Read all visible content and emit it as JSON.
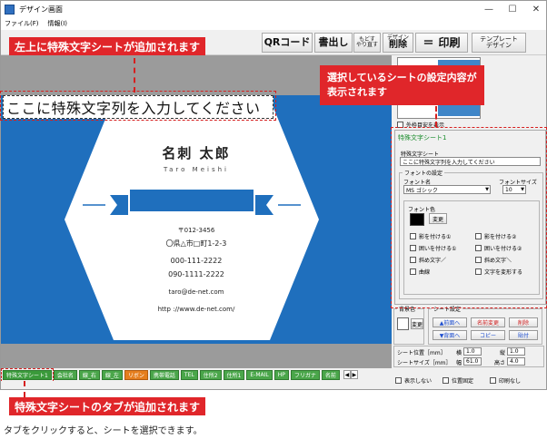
{
  "window": {
    "title": "デザイン画面",
    "controls": [
      "—",
      "☐",
      "✕"
    ]
  },
  "menu": [
    "ファイル(F)",
    "情報(I)"
  ],
  "toolbar": {
    "qr": "QRコード",
    "write": "書出し",
    "undo_top": "もどす",
    "undo_bottom": "やり直す",
    "del_top": "デザイン",
    "del_bottom": "削除",
    "print_sym": "＝",
    "print": "印刷",
    "tmpl_top": "テンプレート",
    "tmpl_bottom": "デザイン"
  },
  "card": {
    "special_text": "ここに特殊文字列を入力してください",
    "name": "名刺 太郎",
    "romaji": "Taro Meishi",
    "postal": "〒012-3456",
    "address": "〇県△市□町1-2-3",
    "tel": "000-111-2222",
    "mobile": "090-1111-2222",
    "email": "taro@de-net.com",
    "url": "http ://www.de-net.com/"
  },
  "panel": {
    "checkbox_label": "外枠目安を表示",
    "sheet_title": "特殊文字シート1",
    "text_label": "特殊文字シート",
    "text_value": "ここに特殊文字列を入力してください",
    "font_group": "フォントの設定",
    "font_name_label": "フォント名",
    "font_size_label": "フォントサイズ",
    "font_name": "MS ゴシック",
    "font_size": "10",
    "font_color_label": "フォント色",
    "change": "変更",
    "opts": [
      "影を付ける①",
      "影を付ける②",
      "囲いを付ける①",
      "囲いを付ける②",
      "斜め文字／",
      "斜め文字＼",
      "曲線",
      "文字を変形する"
    ]
  },
  "lower": {
    "bg_label": "背景色",
    "change": "変更",
    "sheet_group": "シート設定",
    "front": "▲前面へ",
    "rename": "名前変更",
    "delete": "削除",
    "back": "▼背面へ",
    "copy": "コピー",
    "paste": "貼付",
    "pos_label": "シート位置［mm］",
    "size_label": "シートサイズ［mm］",
    "w_label": "横",
    "h_label": "縦",
    "wd_label": "幅",
    "ht_label": "高さ",
    "pos_x": "1.0",
    "pos_y": "1.0",
    "width": "61.0",
    "height": "4.0"
  },
  "bottom_checks": [
    "表示しない",
    "位置固定",
    "印刷なし"
  ],
  "tabs": [
    "特殊文字シート1",
    "会社名",
    "線_右",
    "線_左",
    "リボン",
    "携帯電話",
    "TEL",
    "住所2",
    "住所1",
    "E-MAIL",
    "HP",
    "フリガナ",
    "名前"
  ],
  "callouts": {
    "top_left": "左上に特殊文字シートが追加されます",
    "right": "選択しているシートの設定内容が\n表示されます",
    "bottom": "特殊文字シートのタブが追加されます"
  },
  "caption": "タブをクリックすると、シートを選択できます。",
  "colors": {
    "card_blue": "#1f6fbd",
    "callout_red": "#e0262a",
    "tab_green": "#4aa64a",
    "tab_orange": "#e57e1e"
  }
}
